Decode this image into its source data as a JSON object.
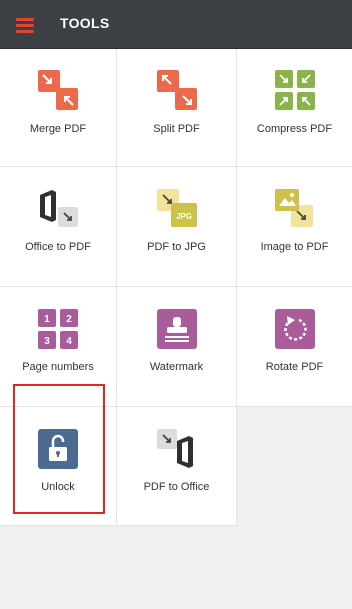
{
  "header": {
    "title": "TOOLS",
    "menu_icon": "hamburger-menu-icon"
  },
  "colors": {
    "header_bg": "#3c3f44",
    "menu_accent": "#e8412c",
    "orange": "#ec6a4b",
    "green": "#8ab44a",
    "yellow": "#f3e39a",
    "olive_yellow": "#cdc14a",
    "purple": "#a85c9a",
    "slate_blue": "#4d6a91",
    "highlight_border": "#e0252b"
  },
  "tools": [
    {
      "label": "Merge PDF",
      "icon": "merge-pdf-icon"
    },
    {
      "label": "Split PDF",
      "icon": "split-pdf-icon"
    },
    {
      "label": "Compress PDF",
      "icon": "compress-pdf-icon"
    },
    {
      "label": "Office to PDF",
      "icon": "office-to-pdf-icon"
    },
    {
      "label": "PDF to JPG",
      "icon": "pdf-to-jpg-icon",
      "badge": "JPG"
    },
    {
      "label": "Image to PDF",
      "icon": "image-to-pdf-icon"
    },
    {
      "label": "Page numbers",
      "icon": "page-numbers-icon",
      "digits": [
        "1",
        "2",
        "3",
        "4"
      ]
    },
    {
      "label": "Watermark",
      "icon": "watermark-stamp-icon"
    },
    {
      "label": "Rotate PDF",
      "icon": "rotate-pdf-icon"
    },
    {
      "label": "Unlock",
      "icon": "unlock-padlock-icon",
      "selected": true
    },
    {
      "label": "PDF to Office",
      "icon": "pdf-to-office-icon"
    }
  ]
}
